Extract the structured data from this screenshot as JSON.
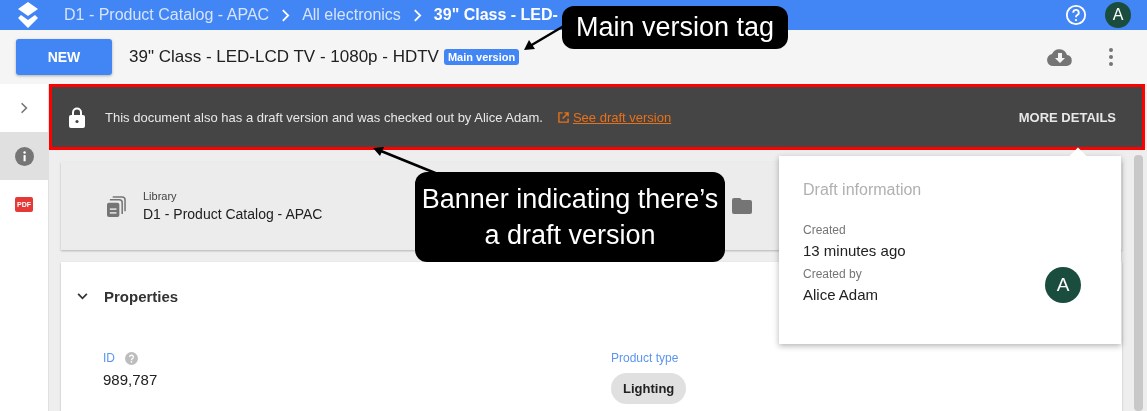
{
  "app_bar": {
    "breadcrumbs": [
      {
        "label": "D1 - Product Catalog - APAC",
        "current": false
      },
      {
        "label": "All electronics",
        "current": false
      },
      {
        "label": "39\" Class - LED-",
        "current": true
      }
    ],
    "avatar": "A"
  },
  "toolbar": {
    "new_button": "NEW",
    "document_title": "39\" Class - LED-LCD TV - 1080p - HDTV",
    "version_tag": "Main version"
  },
  "side_rail": [
    {
      "kind": "expand",
      "selected": false
    },
    {
      "kind": "info",
      "selected": true
    },
    {
      "kind": "pdf",
      "selected": false,
      "label": "PDF"
    }
  ],
  "banner": {
    "message": "This document also has a draft version and was checked out by Alice Adam.",
    "link": "See draft version",
    "action": "MORE DETAILS"
  },
  "location_card": {
    "items": [
      {
        "kind": "library",
        "label": "Library",
        "value": "D1 - Product Catalog - APAC"
      },
      {
        "kind": "folder"
      }
    ]
  },
  "properties": {
    "title": "Properties",
    "expanded": true,
    "fields": [
      {
        "kind": "text",
        "label": "ID",
        "help": true,
        "value": "989,787"
      },
      {
        "kind": "chip",
        "label": "Product type",
        "help": false,
        "value": "Lighting"
      }
    ]
  },
  "draft_popover": {
    "title": "Draft information",
    "fields": [
      {
        "label": "Created",
        "value": "13 minutes ago"
      },
      {
        "label": "Created by",
        "value": "Alice Adam"
      }
    ],
    "avatar": "A"
  },
  "annotations": [
    {
      "text": "Main version tag"
    },
    {
      "text": "Banner indicating there’s a draft version"
    }
  ]
}
